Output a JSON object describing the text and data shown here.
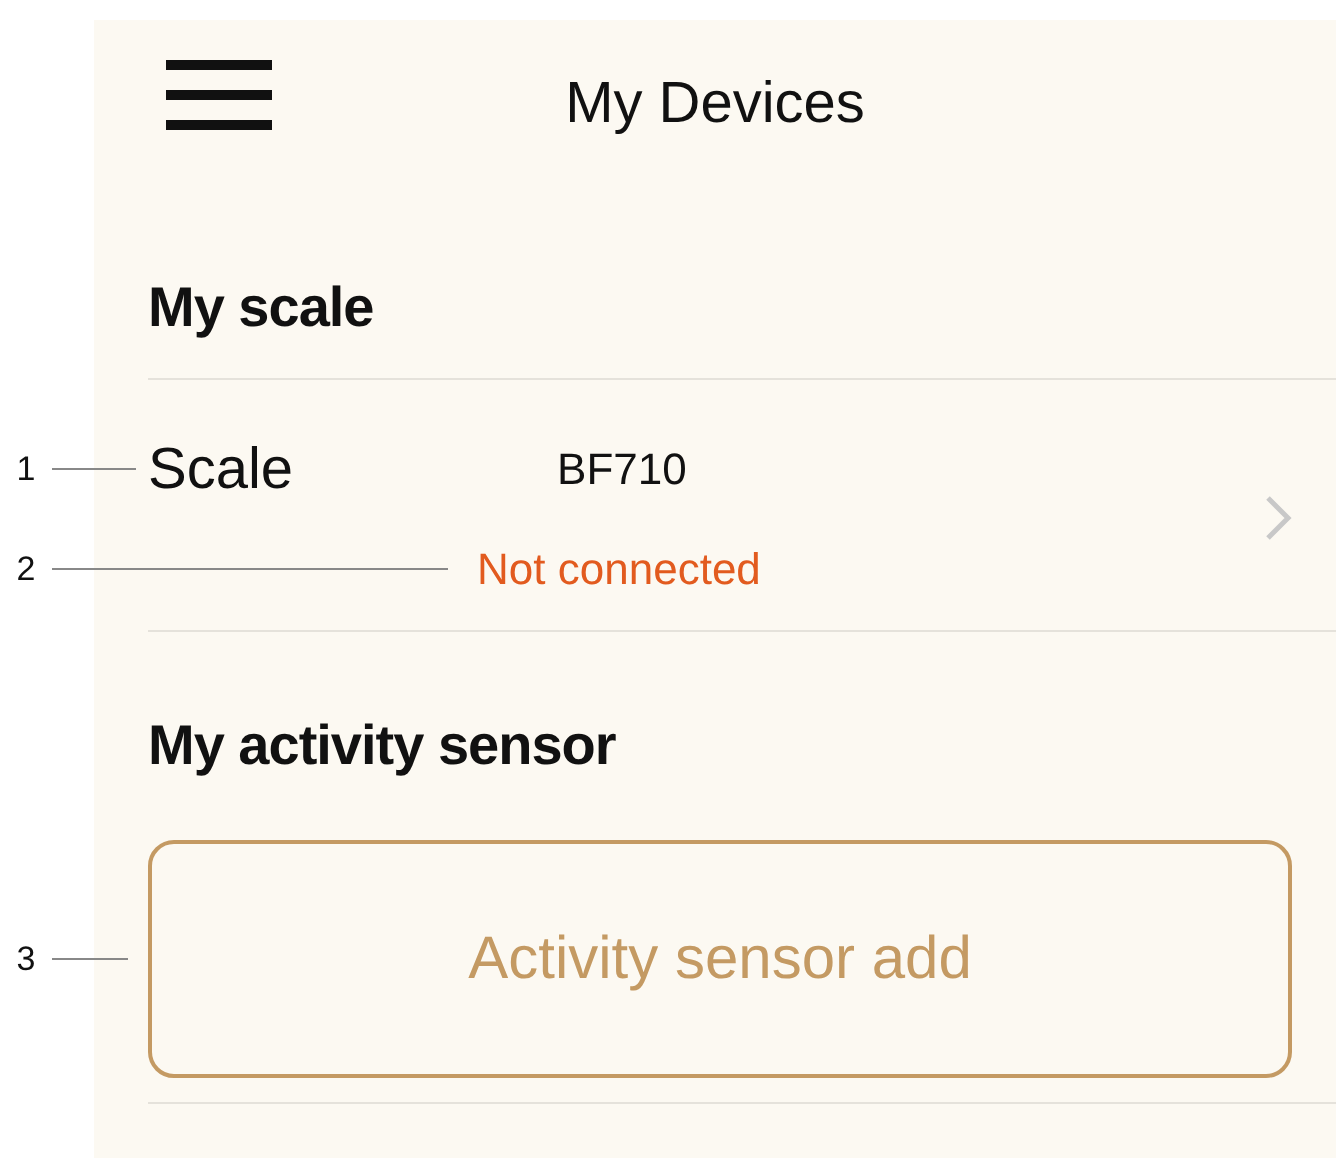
{
  "header": {
    "title": "My Devices"
  },
  "sections": [
    {
      "heading": "My scale",
      "kind": "device",
      "device": {
        "label": "Scale",
        "model": "BF710",
        "status": "Not connected",
        "connected": false
      }
    },
    {
      "heading": "My activity sensor",
      "kind": "add",
      "button": "Activity sensor add"
    }
  ],
  "callouts": [
    {
      "label": "1"
    },
    {
      "label": "2"
    },
    {
      "label": "3"
    }
  ]
}
